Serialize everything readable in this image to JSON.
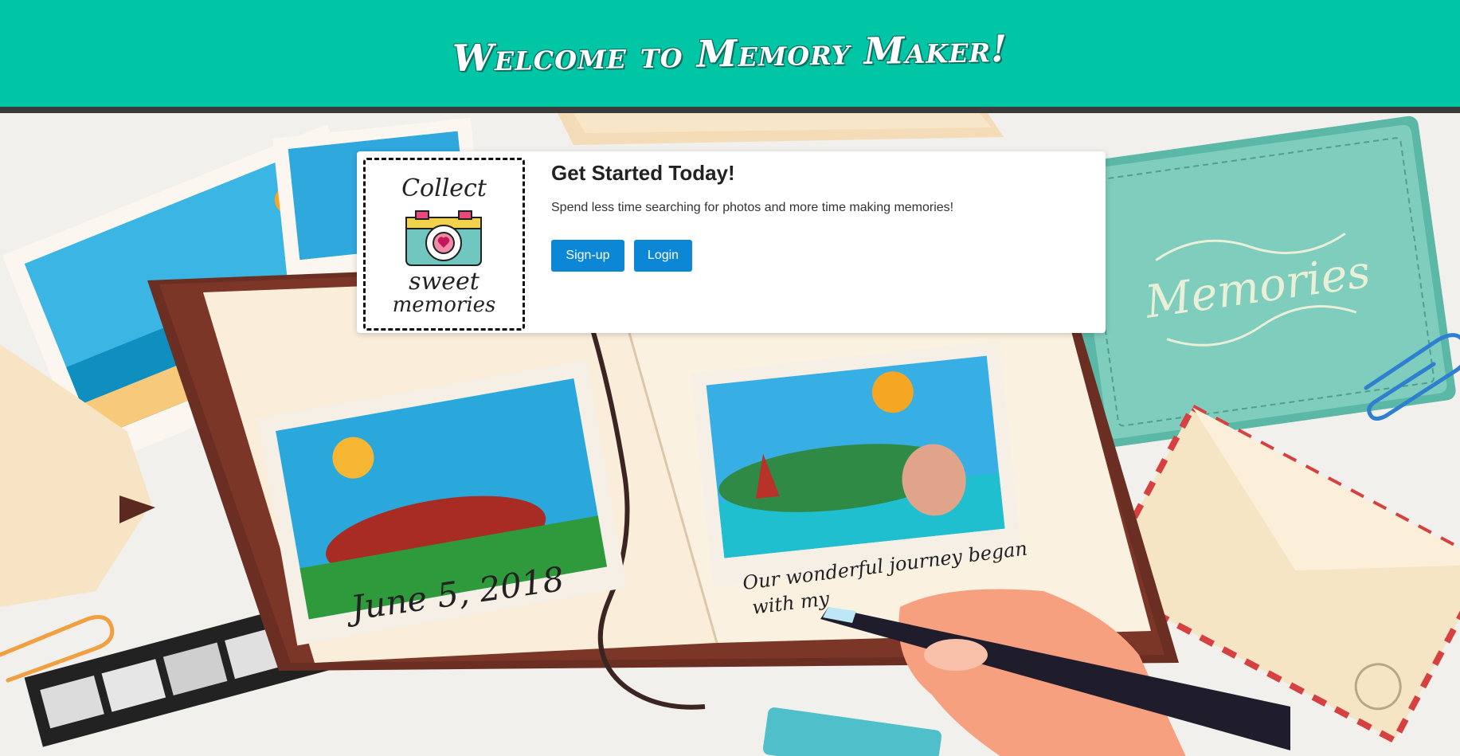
{
  "header": {
    "title": "Welcome to Memory Maker!"
  },
  "hero": {
    "logo": {
      "line1": "Collect",
      "line2": "sweet",
      "line3": "memories"
    },
    "title": "Get Started Today!",
    "text": "Spend less time searching for photos and more time making memories!",
    "signup_label": "Sign-up",
    "login_label": "Login"
  },
  "background": {
    "album_date": "June 5, 2018",
    "album_caption_line1": "Our wonderful journey began",
    "album_caption_line2": "with my",
    "book_title": "Memories"
  },
  "colors": {
    "header_bg": "#00c6a6",
    "header_bar": "#3b3b3b",
    "button_bg": "#0b87d6",
    "page_bg": "#f1f0ec"
  }
}
